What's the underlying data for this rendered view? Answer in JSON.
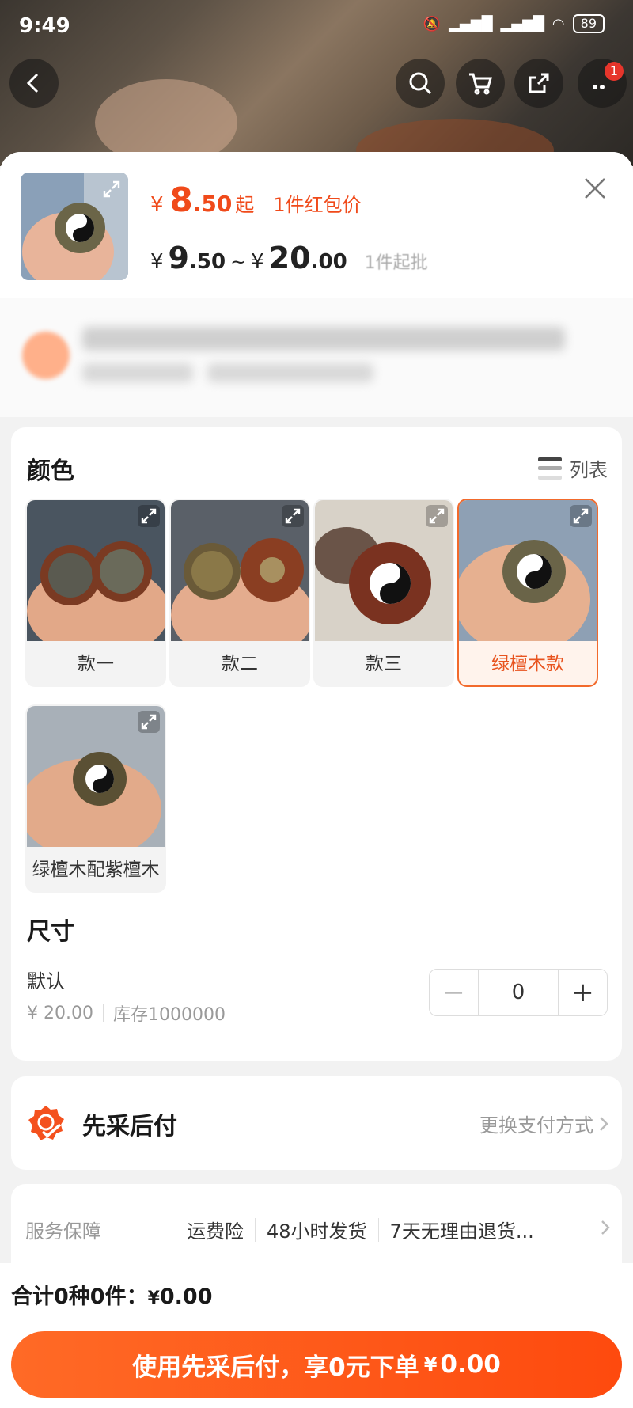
{
  "status_bar": {
    "time": "9:49",
    "battery": "89"
  },
  "nav": {
    "cart_badge": "1"
  },
  "header": {
    "price_main_yen": "¥",
    "price_main_int": "8",
    "price_main_dec": ".50",
    "price_main_suffix": "起",
    "price_main_tag": "1件红包价",
    "range_low_yen": "¥",
    "range_low_int": "9",
    "range_low_dec": ".50",
    "range_tilde": "~",
    "range_high_yen": "¥",
    "range_high_int": "20",
    "range_high_dec": ".00",
    "moq": "1件起批"
  },
  "colors_section": {
    "title": "颜色",
    "list_toggle": "列表",
    "variants": [
      {
        "label": "款一"
      },
      {
        "label": "款二"
      },
      {
        "label": "款三"
      },
      {
        "label": "绿檀木款",
        "selected": true
      },
      {
        "label": "绿檀木配紫檀木"
      }
    ]
  },
  "size_section": {
    "title": "尺寸",
    "name": "默认",
    "price": "¥ 20.00",
    "stock": "库存1000000",
    "quantity": "0",
    "minus": "−",
    "plus": "+"
  },
  "payment": {
    "title": "先采后付",
    "link": "更换支付方式"
  },
  "service": {
    "label": "服务保障",
    "items": [
      "运费险",
      "48小时发货",
      "7天无理由退货..."
    ]
  },
  "footer": {
    "total_prefix": "合计0种0件：",
    "total_yen": "¥",
    "total_value": "0.00",
    "buy_text": "使用先采后付，享0元下单",
    "buy_yen": "¥",
    "buy_value": "0.00"
  },
  "theme": {
    "accent": "#f04a1a",
    "button": "#fe4a0e"
  }
}
